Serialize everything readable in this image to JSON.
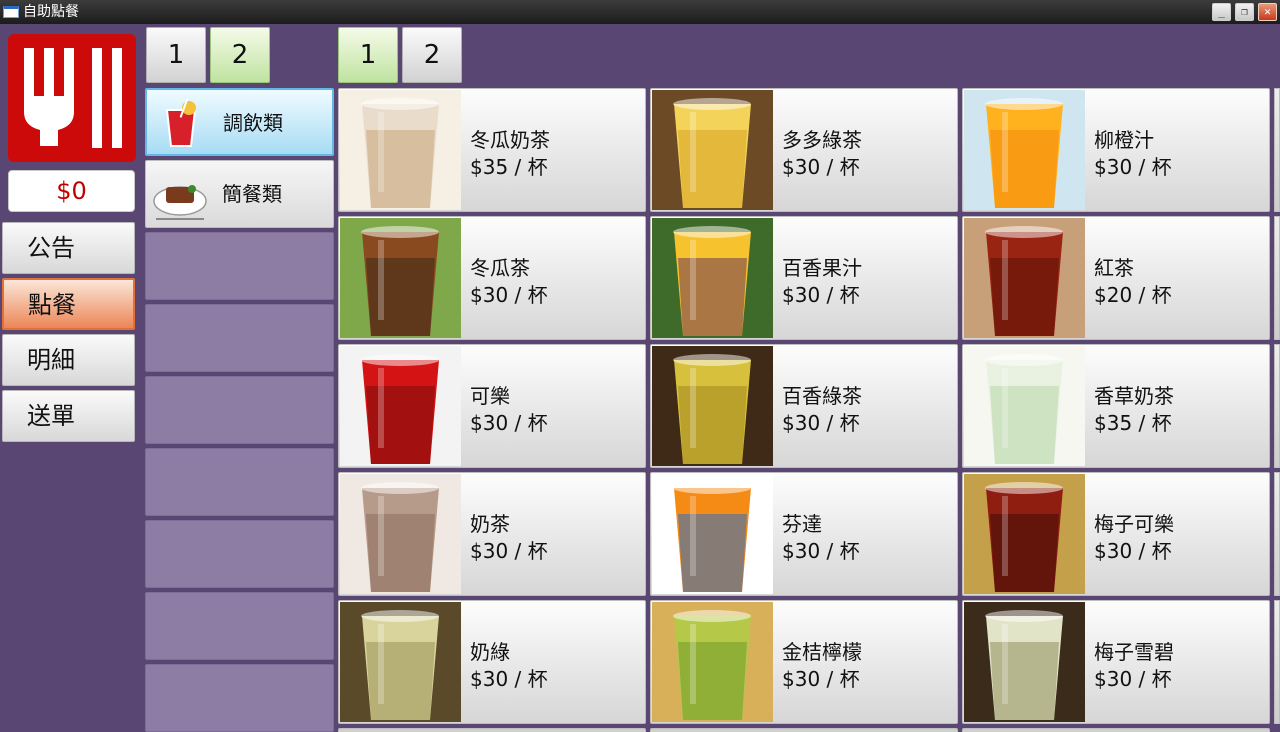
{
  "window": {
    "title": "自助點餐"
  },
  "sidebar": {
    "total": "$0",
    "nav": [
      {
        "label": "公告",
        "name": "nav-announcement-button",
        "active": false
      },
      {
        "label": "點餐",
        "name": "nav-order-button",
        "active": true
      },
      {
        "label": "明細",
        "name": "nav-details-button",
        "active": false
      },
      {
        "label": "送單",
        "name": "nav-submit-button",
        "active": false
      }
    ]
  },
  "category_pages": [
    {
      "label": "1",
      "active": false
    },
    {
      "label": "2",
      "active": true
    }
  ],
  "item_pages": [
    {
      "label": "1",
      "active": true
    },
    {
      "label": "2",
      "active": false
    }
  ],
  "categories": [
    {
      "label": "調飲類",
      "icon": "drink-icon",
      "active": true
    },
    {
      "label": "簡餐類",
      "icon": "meal-plate-icon",
      "active": false
    }
  ],
  "items": [
    {
      "name": "冬瓜奶茶",
      "price": "$35 / 杯",
      "colors": [
        "#e9dccb",
        "#c7a57c",
        "#f6efe4"
      ]
    },
    {
      "name": "多多綠茶",
      "price": "$30 / 杯",
      "colors": [
        "#f3d35a",
        "#d6a323",
        "#6b4a25"
      ]
    },
    {
      "name": "柳橙汁",
      "price": "$30 / 杯",
      "colors": [
        "#ffb21e",
        "#f48a0c",
        "#cfe6f0"
      ]
    },
    {
      "name": "冬瓜茶",
      "price": "$30 / 杯",
      "colors": [
        "#8a4a1f",
        "#3d2a1a",
        "#7fa84b"
      ]
    },
    {
      "name": "百香果汁",
      "price": "$30 / 杯",
      "colors": [
        "#f6c22e",
        "#6b3a57",
        "#3f6b2a"
      ]
    },
    {
      "name": "紅茶",
      "price": "$20 / 杯",
      "colors": [
        "#9a2412",
        "#5b1208",
        "#c7a07a"
      ]
    },
    {
      "name": "可樂",
      "price": "$30 / 杯",
      "colors": [
        "#d41414",
        "#7a0d0d",
        "#f3f3f3"
      ]
    },
    {
      "name": "百香綠茶",
      "price": "$30 / 杯",
      "colors": [
        "#d7c13c",
        "#a2861e",
        "#3f2a17"
      ]
    },
    {
      "name": "香草奶茶",
      "price": "$35 / 杯",
      "colors": [
        "#e9f2e1",
        "#b7d7a7",
        "#f7f7f2"
      ]
    },
    {
      "name": "奶茶",
      "price": "$30 / 杯",
      "colors": [
        "#b79b8a",
        "#8d6e5c",
        "#f0e8e2"
      ]
    },
    {
      "name": "芬達",
      "price": "$30 / 杯",
      "colors": [
        "#f58a14",
        "#2b6fc4",
        "#ffffff"
      ]
    },
    {
      "name": "梅子可樂",
      "price": "$30 / 杯",
      "colors": [
        "#8f1d10",
        "#3f0f08",
        "#c4a04a"
      ]
    },
    {
      "name": "奶綠",
      "price": "$30 / 杯",
      "colors": [
        "#d8d49c",
        "#9b8f57",
        "#5a4a2a"
      ]
    },
    {
      "name": "金桔檸檬",
      "price": "$30 / 杯",
      "colors": [
        "#b6c848",
        "#6f9a2a",
        "#d8b05a"
      ]
    },
    {
      "name": "梅子雪碧",
      "price": "$30 / 杯",
      "colors": [
        "#e2e4c8",
        "#8f8f5c",
        "#3a2b1a"
      ]
    }
  ]
}
